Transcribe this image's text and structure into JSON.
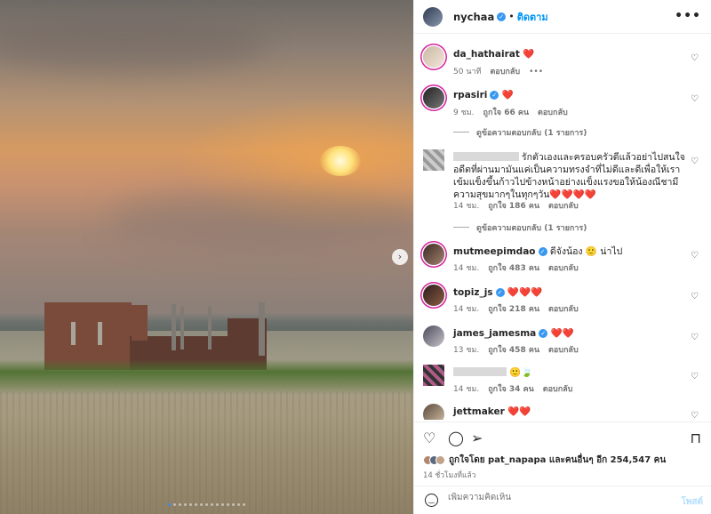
{
  "post": {
    "username": "nychaa",
    "follow_label": "ติดตาม",
    "more_label": "•••",
    "next_arrow": "›",
    "carousel_total": 15,
    "carousel_active": 0
  },
  "comments": [
    {
      "username": "da_hathairat",
      "text": "❤️",
      "time": "50 นาที",
      "reply": "ตอบกลับ",
      "more": "•••"
    },
    {
      "username": "rpasiri",
      "text": "❤️",
      "time": "9 ชม.",
      "likes": "ถูกใจ 66 คน",
      "reply": "ตอบกลับ",
      "view_replies": "ดูข้อความตอบกลับ (1 รายการ)"
    },
    {
      "username": "",
      "text": "รักตัวเองและครอบครัวดีแล้วอย่าไปสนใจอดีตที่ผ่านมามันแค่เป็นความทรงจำที่ไม่ดีและดีเพื่อให้เราเข้มแข็งขึ้นก้าวไปข้างหน้าอย่างแข็งแรงขอให้น้องณีชามีความสุขมากๆในทุกๆวัน❤️❤️❤️❤️",
      "time": "14 ชม.",
      "likes": "ถูกใจ 186 คน",
      "reply": "ตอบกลับ",
      "view_replies": "ดูข้อความตอบกลับ (1 รายการ)"
    },
    {
      "username": "mutmeepimdao",
      "text": "ดีจังน้อง 🙂 น่าไป",
      "time": "14 ชม.",
      "likes": "ถูกใจ 483 คน",
      "reply": "ตอบกลับ"
    },
    {
      "username": "topiz_js",
      "text": "❤️❤️❤️",
      "time": "14 ชม.",
      "likes": "ถูกใจ 218 คน",
      "reply": "ตอบกลับ"
    },
    {
      "username": "james_jamesma",
      "text": "❤️❤️",
      "time": "13 ชม.",
      "likes": "ถูกใจ 458 คน",
      "reply": "ตอบกลับ"
    },
    {
      "username": "",
      "text": "🙂🍃",
      "time": "14 ชม.",
      "likes": "ถูกใจ 34 คน",
      "reply": "ตอบกลับ"
    },
    {
      "username": "jettmaker",
      "text": "❤️❤️"
    }
  ],
  "actions": {
    "like_icon": "♡",
    "comment_icon": "◯",
    "share_icon": "➢",
    "save_icon": "⊓"
  },
  "likes_summary": {
    "text": "ถูกใจโดย pat_napapa และคนอื่นๆ อีก 254,547 คน",
    "time": "14 ชั่วโมงที่แล้ว"
  },
  "add_comment": {
    "placeholder": "เพิ่มความคิดเห็น",
    "post_label": "โพสต์"
  },
  "colors": {
    "accent": "#0095f6",
    "heart": "#ed1c3a",
    "verified": "#3897f0"
  }
}
